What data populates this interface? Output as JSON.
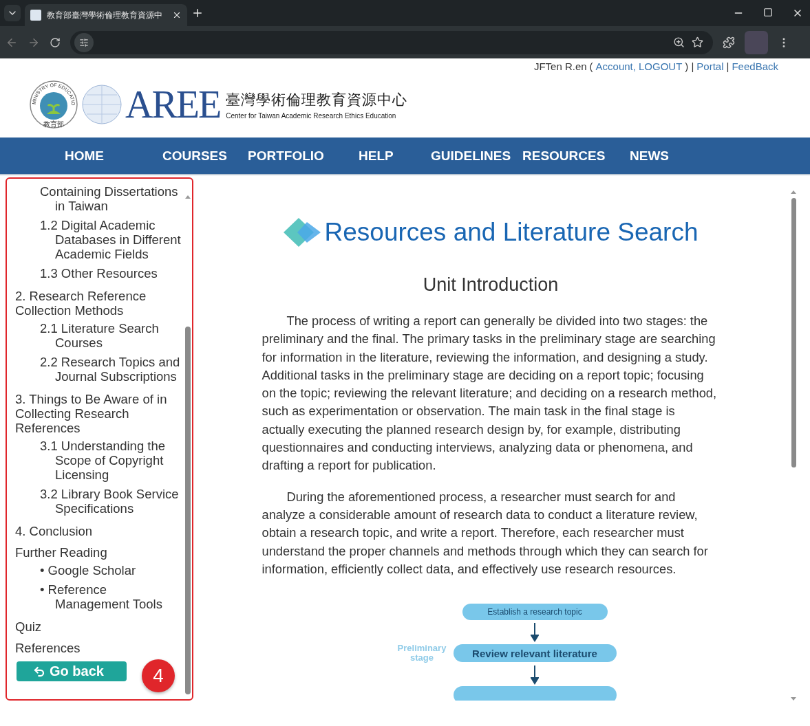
{
  "browser": {
    "tab_title": "教育部臺灣學術倫理教育資源中"
  },
  "header": {
    "user": "JFTen R.en",
    "user_links": [
      {
        "kind": "open",
        "text": "("
      },
      {
        "kind": "link",
        "text": "Account,"
      },
      {
        "kind": "link",
        "text": "LOGOUT"
      },
      {
        "kind": "sep",
        "text": ") |"
      },
      {
        "kind": "link",
        "text": "Portal"
      },
      {
        "kind": "sep",
        "text": "|"
      },
      {
        "kind": "link",
        "text": "FeedBack"
      }
    ],
    "seal_text": "MINISTRY OF EDUCATION",
    "seal_bottom": "教育部",
    "logo_mark": "AREE",
    "logo_title": "臺灣學術倫理教育資源中心",
    "logo_subtitle": "Center for Taiwan Academic Research Ethics Education"
  },
  "nav": [
    "HOME",
    "COURSES",
    "PORTFOLIO",
    "HELP",
    "GUIDELINES",
    "RESOURCES",
    "NEWS"
  ],
  "sidebar": {
    "items": [
      {
        "children": [
          {
            "text": "Containing Dissertations in Taiwan"
          },
          {
            "text": "1.2 Digital Academic Databases in Different Academic Fields"
          },
          {
            "text": "1.3 Other Resources"
          }
        ]
      },
      {
        "text": "2. Research Reference Collection Methods",
        "children": [
          {
            "text": "2.1 Literature Search Courses"
          },
          {
            "text": "2.2 Research Topics and Journal Subscriptions"
          }
        ]
      },
      {
        "text": "3. Things to Be Aware of in Collecting Research References",
        "children": [
          {
            "text": "3.1 Understanding the Scope of Copyright Licensing"
          },
          {
            "text": "3.2 Library Book Service Specifications"
          }
        ]
      },
      {
        "text": "4. Conclusion"
      },
      {
        "text": "Further Reading",
        "children": [
          {
            "text": "• Google Scholar"
          },
          {
            "text": "• Reference Management Tools"
          }
        ]
      },
      {
        "text": "Quiz"
      },
      {
        "text": "References"
      }
    ],
    "back_button": "Go back",
    "badge": "4"
  },
  "main": {
    "title": "Resources and Literature Search",
    "section": "Unit Introduction",
    "paragraphs": [
      "The process of writing a report can generally be divided into two stages: the preliminary and the final. The primary tasks in the preliminary stage are searching for information in the literature, reviewing the information, and designing a study. Additional tasks in the preliminary stage are deciding on a report topic; focusing on the topic; reviewing the relevant literature; and deciding on a research method, such as experimentation or observation. The main task in the final stage is actually executing the planned research design by, for example, distributing questionnaires and conducting interviews, analyzing data or phenomena, and drafting a report for publication.",
      "During the aforementioned process, a researcher must search for and analyze a considerable amount of research data to conduct a literature review, obtain a research topic, and write a report. Therefore, each researcher must understand the proper channels and methods through which they can search for information, efficiently collect data, and effectively use research resources."
    ],
    "flowchart": {
      "stage_label": "Preliminary stage",
      "steps": [
        {
          "text": "Establish a research topic",
          "emphasis": false
        },
        {
          "text": "Review relevant literature",
          "emphasis": true
        }
      ]
    }
  }
}
